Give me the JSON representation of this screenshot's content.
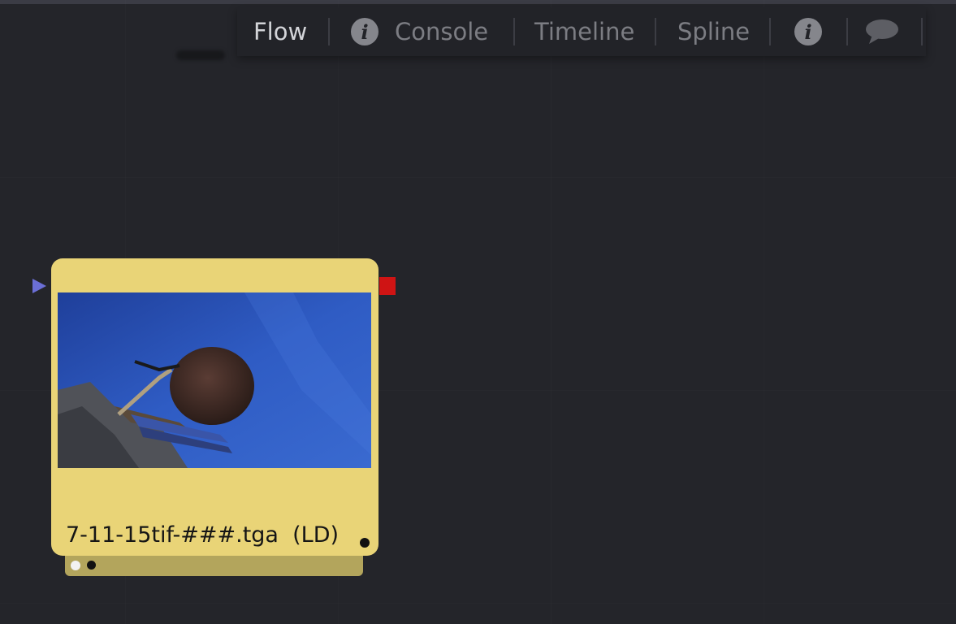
{
  "tabs": {
    "flow": "Flow",
    "console": "Console",
    "timeline": "Timeline",
    "spline": "Spline"
  },
  "icons": {
    "info_glyph": "i",
    "console_icon": "info-icon",
    "info_button": "info-icon",
    "comments_button": "speech-bubble-icon"
  },
  "node": {
    "title": "7-11-15tif-###.tga  (LD)",
    "color": "#e9d477",
    "input_color": "#6b6fd6",
    "output_color": "#cf1414"
  }
}
